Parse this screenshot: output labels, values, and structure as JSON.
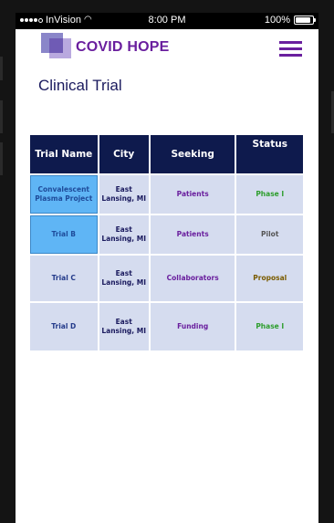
{
  "status_bar": {
    "carrier": "InVision",
    "time": "8:00 PM",
    "battery": "100%"
  },
  "app": {
    "brand": "COVID HOPE",
    "page_title": "Clinical Trial"
  },
  "colors": {
    "brand": "#6a1f9e",
    "header": "#0e1a4d",
    "cell": "#d5dcef",
    "selected": "#5fb5f5"
  },
  "table": {
    "headers": [
      "Trial Name",
      "City",
      "Seeking",
      "Status"
    ],
    "rows": [
      {
        "name": "Convalescent Plasma Project",
        "city": "East Lansing, MI",
        "seeking": "Patients",
        "status": "Phase I"
      },
      {
        "name": "Trial B",
        "city": "East Lansing, MI",
        "seeking": "Patients",
        "status": "Pilot"
      },
      {
        "name": "Trial C",
        "city": "East Lansing, MI",
        "seeking": "Collaborators",
        "status": "Proposal"
      },
      {
        "name": "Trial D",
        "city": "East Lansing, MI",
        "seeking": "Funding",
        "status": "Phase I"
      }
    ]
  },
  "icons": {
    "menu": "hamburger-menu-icon",
    "wifi": "wifi-icon",
    "battery": "battery-icon",
    "signal": "signal-dots-icon"
  }
}
